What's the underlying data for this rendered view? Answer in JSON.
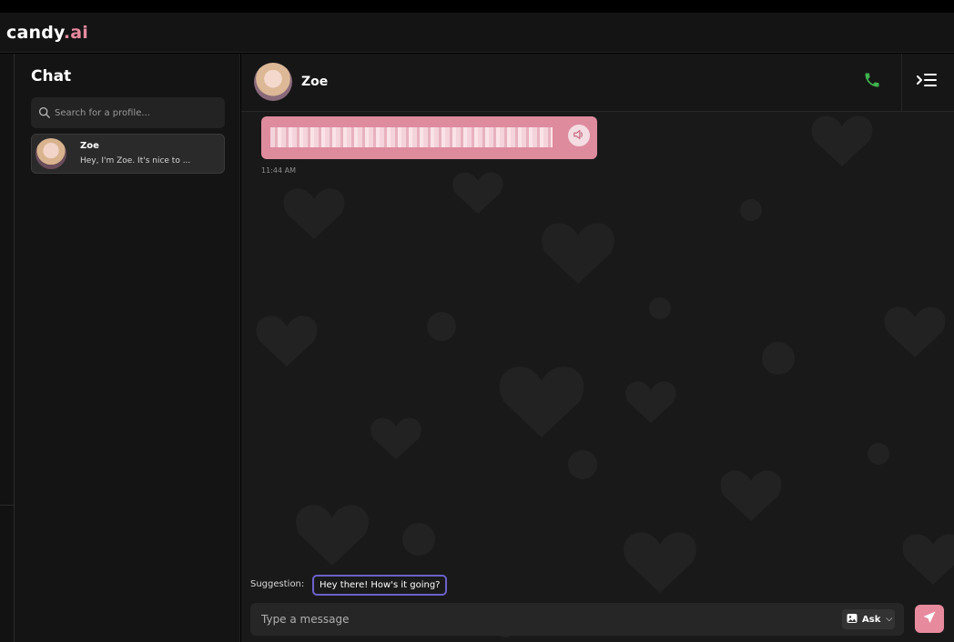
{
  "app": {
    "logo_text": "candy",
    "logo_accent": ".ai",
    "accent_color": "#e88aa0"
  },
  "sidebar": {
    "title": "Chat",
    "search_placeholder": "Search for a profile...",
    "conversations": [
      {
        "name": "Zoe",
        "preview": "Hey, I'm Zoe. It's nice to ..."
      }
    ]
  },
  "chat": {
    "contact_name": "Zoe",
    "icons": {
      "call": "phone-icon",
      "menu": "menu-collapse-icon",
      "speaker": "speaker-icon"
    },
    "messages": [
      {
        "from": "Zoe",
        "text_redacted": true,
        "timestamp": "11:44 AM"
      }
    ],
    "suggestion_label": "Suggestion:",
    "suggestion_text": "Hey there! How's it going?",
    "composer_placeholder": "Type a message",
    "ask_label": "Ask"
  },
  "colors": {
    "bubble": "#de8b9e",
    "send_button": "#e88a9e",
    "call_icon": "#3fb24e",
    "suggestion_border": "#6b61c9"
  }
}
